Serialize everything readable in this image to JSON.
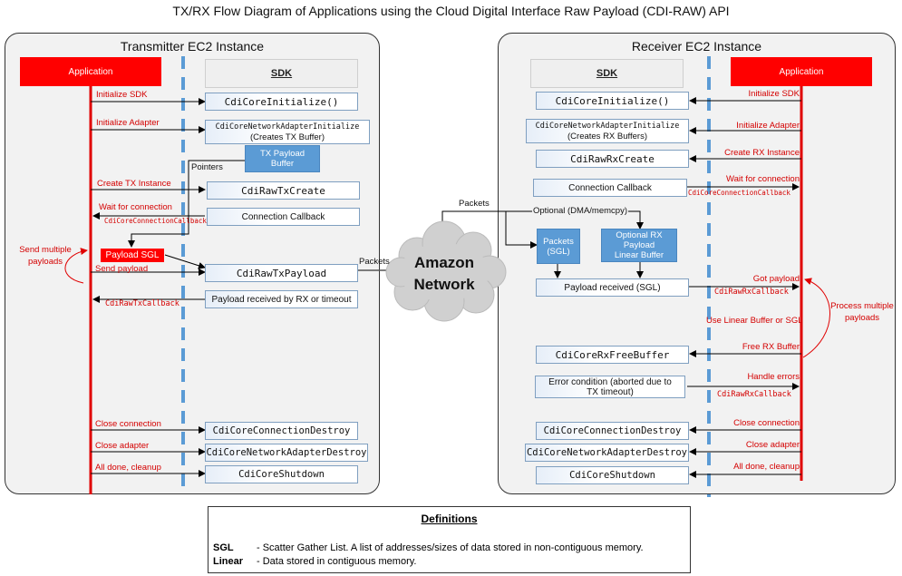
{
  "title": "TX/RX Flow Diagram of Applications using the Cloud Digital Interface Raw Payload (CDI-RAW) API",
  "colors": {
    "app_red": "#ff0000",
    "label_red": "#d40000",
    "sdk_blue": "#5b9bd5",
    "divider_blue": "#5b9bd5",
    "panel_bg": "#f2f2f2"
  },
  "transmitter": {
    "title": "Transmitter EC2 Instance",
    "app_label": "Application",
    "sdk_label": "SDK",
    "functions": {
      "init": "CdiCoreInitialize()",
      "adapter_init": "CdiCoreNetworkAdapterInitialize",
      "adapter_init_sub": "(Creates TX Buffer)",
      "tx_create": "CdiRawTxCreate",
      "conn_cb": "Connection Callback",
      "tx_payload": "CdiRawTxPayload",
      "payload_received": "Payload received by RX or timeout",
      "conn_destroy": "CdiCoreConnectionDestroy",
      "adapter_destroy": "CdiCoreNetworkAdapterDestroy",
      "shutdown": "CdiCoreShutdown"
    },
    "buffer": "TX Payload Buffer",
    "payload_sgl": "Payload SGL",
    "labels": {
      "init_sdk": "Initialize SDK",
      "init_adapter": "Initialize Adapter",
      "create_tx": "Create TX Instance",
      "wait_conn": "Wait for connection",
      "conn_cb_name": "CdiCoreConnectionCallback",
      "send_multiple": "Send multiple payloads",
      "send_payload": "Send payload",
      "tx_cb_name": "CdiRawTxCallback",
      "close_conn": "Close connection",
      "close_adapter": "Close adapter",
      "cleanup": "All done, cleanup",
      "pointers": "Pointers",
      "packets": "Packets"
    }
  },
  "network": {
    "line1": "Amazon",
    "line2": "Network",
    "packets": "Packets"
  },
  "receiver": {
    "title": "Receiver EC2 Instance",
    "app_label": "Application",
    "sdk_label": "SDK",
    "functions": {
      "init": "CdiCoreInitialize()",
      "adapter_init": "CdiCoreNetworkAdapterInitialize",
      "adapter_init_sub": "(Creates RX Buffers)",
      "rx_create": "CdiRawRxCreate",
      "conn_cb": "Connection Callback",
      "payload_received": "Payload received (SGL)",
      "free_buffer": "CdiCoreRxFreeBuffer",
      "error": "Error condition (aborted due to TX timeout)",
      "conn_destroy": "CdiCoreConnectionDestroy",
      "adapter_destroy": "CdiCoreNetworkAdapterDestroy",
      "shutdown": "CdiCoreShutdown"
    },
    "packets_sgl": "Packets (SGL)",
    "linear_buffer": "Optional RX Payload Linear Buffer",
    "optional": "Optional (DMA/memcpy)",
    "labels": {
      "init_sdk": "Initialize SDK",
      "init_adapter": "Initialize Adapter",
      "create_rx": "Create RX Instance",
      "wait_conn": "Wait for connection",
      "conn_cb_name": "CdiCoreConnectionCallback",
      "got_payload": "Got payload",
      "rx_cb_name": "CdiRawRxCallback",
      "use_linear": "Use Linear Buffer or SGL",
      "process_multiple": "Process multiple payloads",
      "free_rx": "Free RX Buffer",
      "handle_errors": "Handle errors",
      "rx_cb_name2": "CdiRawRxCallback",
      "close_conn": "Close connection",
      "close_adapter": "Close adapter",
      "cleanup": "All done, cleanup"
    }
  },
  "definitions": {
    "title": "Definitions",
    "items": [
      {
        "term": "SGL",
        "desc": "- Scatter Gather List. A list of addresses/sizes of data stored in non-contiguous memory."
      },
      {
        "term": "Linear",
        "desc": "- Data stored in contiguous memory."
      }
    ]
  }
}
